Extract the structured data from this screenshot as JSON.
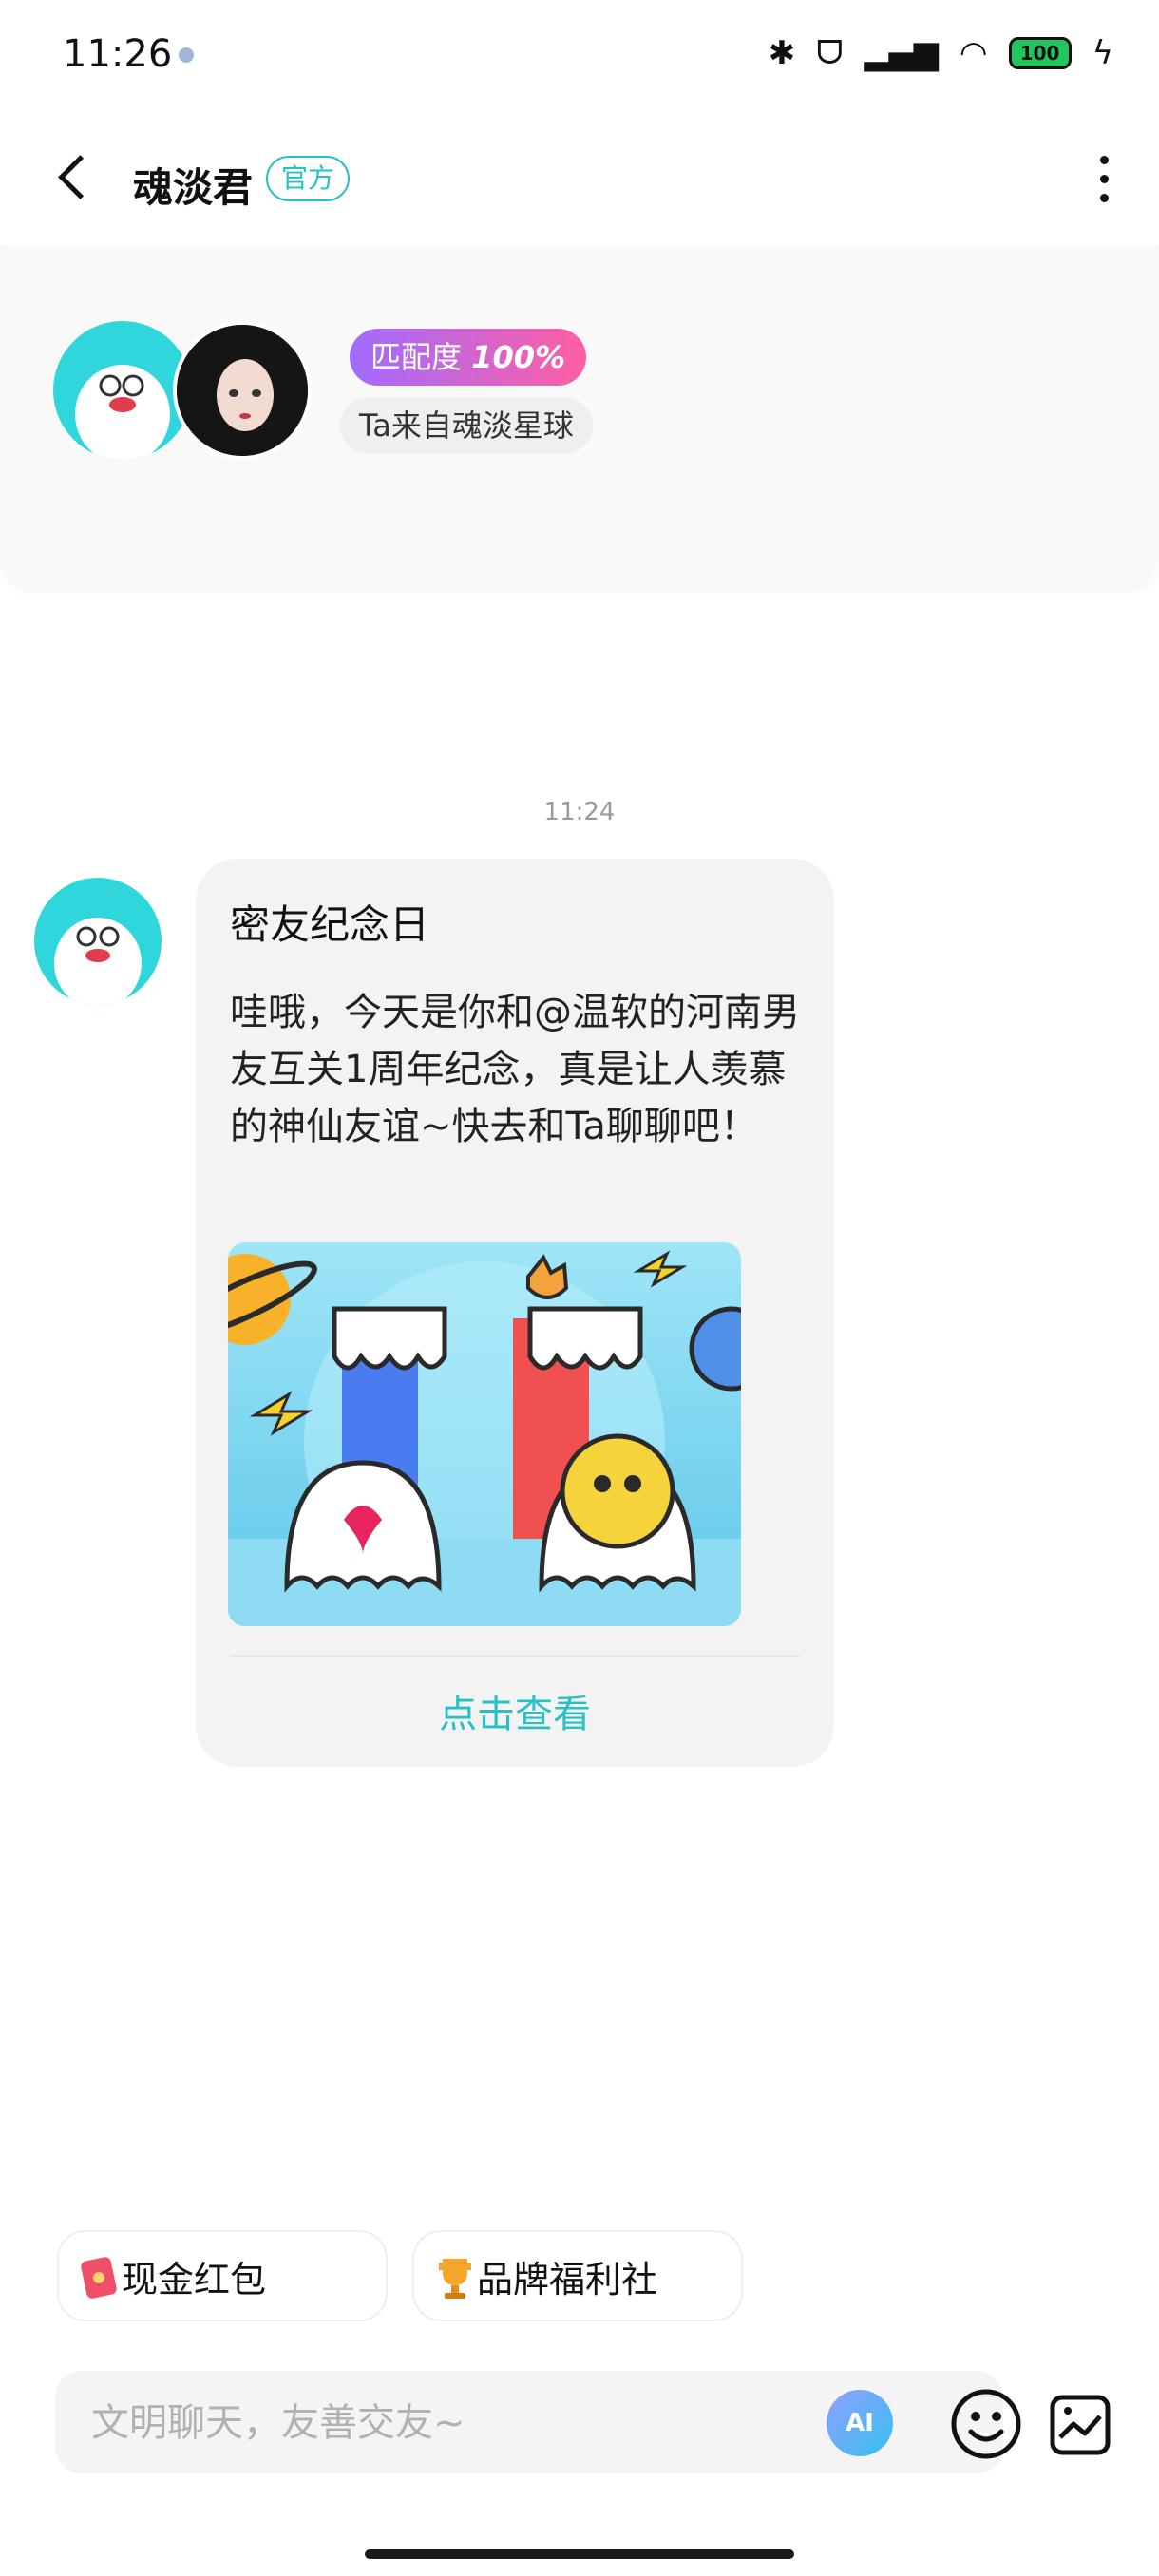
{
  "status_bar": {
    "time": "11:26",
    "battery": "100"
  },
  "header": {
    "title": "魂淡君",
    "badge": "官方"
  },
  "profile": {
    "match_label": "匹配度",
    "match_value": "100%",
    "origin": "Ta来自魂淡星球"
  },
  "chat": {
    "timestamp": "11:24",
    "message": {
      "title": "密友纪念日",
      "body": "哇哦，今天是你和@温软的河南男友互关1周年纪念，真是让人羡慕的神仙友谊~快去和Ta聊聊吧！",
      "link": "点击查看"
    }
  },
  "quick_actions": [
    {
      "label": "现金红包",
      "icon": "red-envelope-icon"
    },
    {
      "label": "品牌福利社",
      "icon": "trophy-icon"
    }
  ],
  "composer": {
    "placeholder": "文明聊天，友善交友~",
    "ai_label": "AI"
  }
}
